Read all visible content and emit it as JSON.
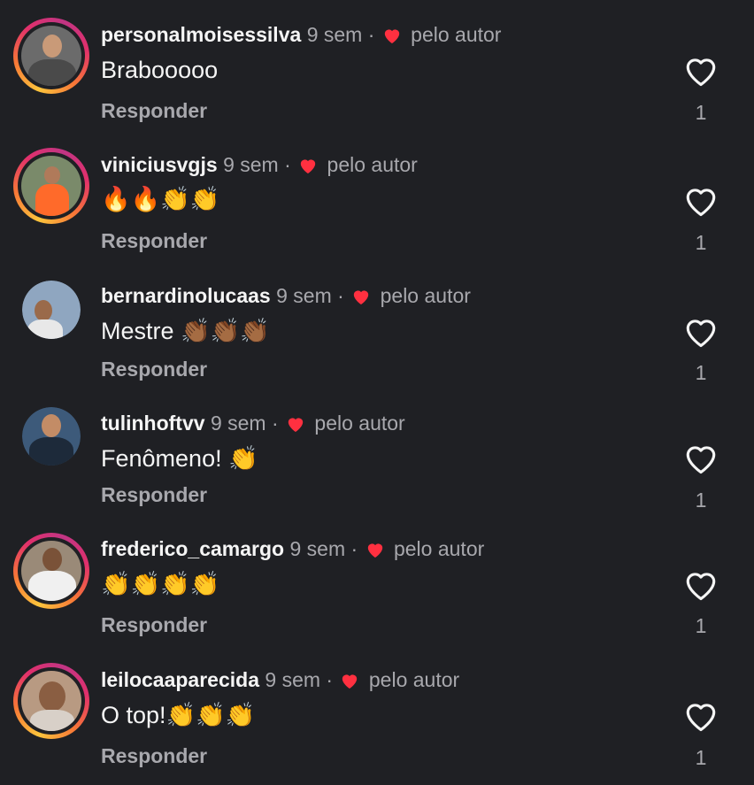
{
  "comments": [
    {
      "username": "personalmoisessilva",
      "time": "9 sem",
      "dot": "·",
      "by_author": "pelo autor",
      "text": "Brabooooo",
      "reply": "Responder",
      "likes": "1",
      "ring": true
    },
    {
      "username": "viniciusvgjs",
      "time": "9 sem",
      "dot": "·",
      "by_author": "pelo autor",
      "text": "🔥🔥👏👏",
      "reply": "Responder",
      "likes": "1",
      "ring": true
    },
    {
      "username": "bernardinolucaas",
      "time": "9 sem",
      "dot": "·",
      "by_author": "pelo autor",
      "text": "Mestre 👏🏾👏🏾👏🏾",
      "reply": "Responder",
      "likes": "1",
      "ring": false
    },
    {
      "username": "tulinhoftvv",
      "time": "9 sem",
      "dot": "·",
      "by_author": "pelo autor",
      "text": "Fenômeno! 👏",
      "reply": "Responder",
      "likes": "1",
      "ring": false
    },
    {
      "username": "frederico_camargo",
      "time": "9 sem",
      "dot": "·",
      "by_author": "pelo autor",
      "text": "👏👏👏👏",
      "reply": "Responder",
      "likes": "1",
      "ring": true
    },
    {
      "username": "leilocaaparecida",
      "time": "9 sem",
      "dot": "·",
      "by_author": "pelo autor",
      "text": "O top!👏👏👏",
      "reply": "Responder",
      "likes": "1",
      "ring": true
    }
  ],
  "colors": {
    "background": "#1f2024",
    "heart": "#ff3040",
    "secondary_text": "#a8a8ad"
  },
  "icons": {
    "liked_by_author": "heart-filled-icon",
    "like": "heart-outline-icon"
  }
}
